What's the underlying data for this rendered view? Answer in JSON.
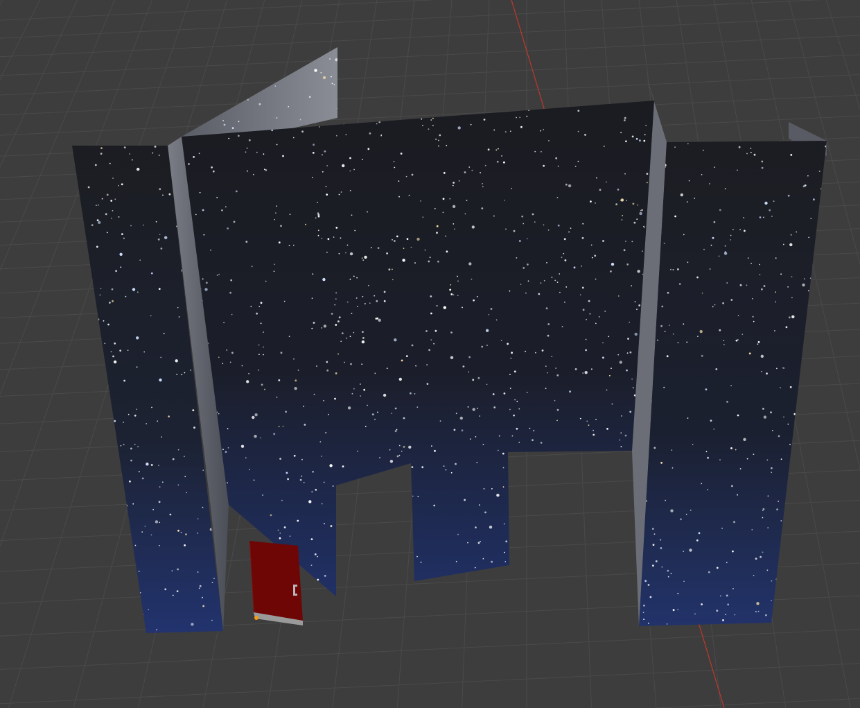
{
  "viewport": {
    "background_color": "#3d3d3d",
    "grid_line_color": "#4a4a4a",
    "x_axis_color": "#c0392b",
    "wall_texture": "starfield",
    "sky_top_color": "#1c1d22",
    "sky_bottom_color": "#1e2a55",
    "wall_edge_color": "#6b6e78",
    "door_color": "#6e0606",
    "door_frame_color": "#9a9a9a",
    "origin_marker_color": "#f39c12"
  }
}
